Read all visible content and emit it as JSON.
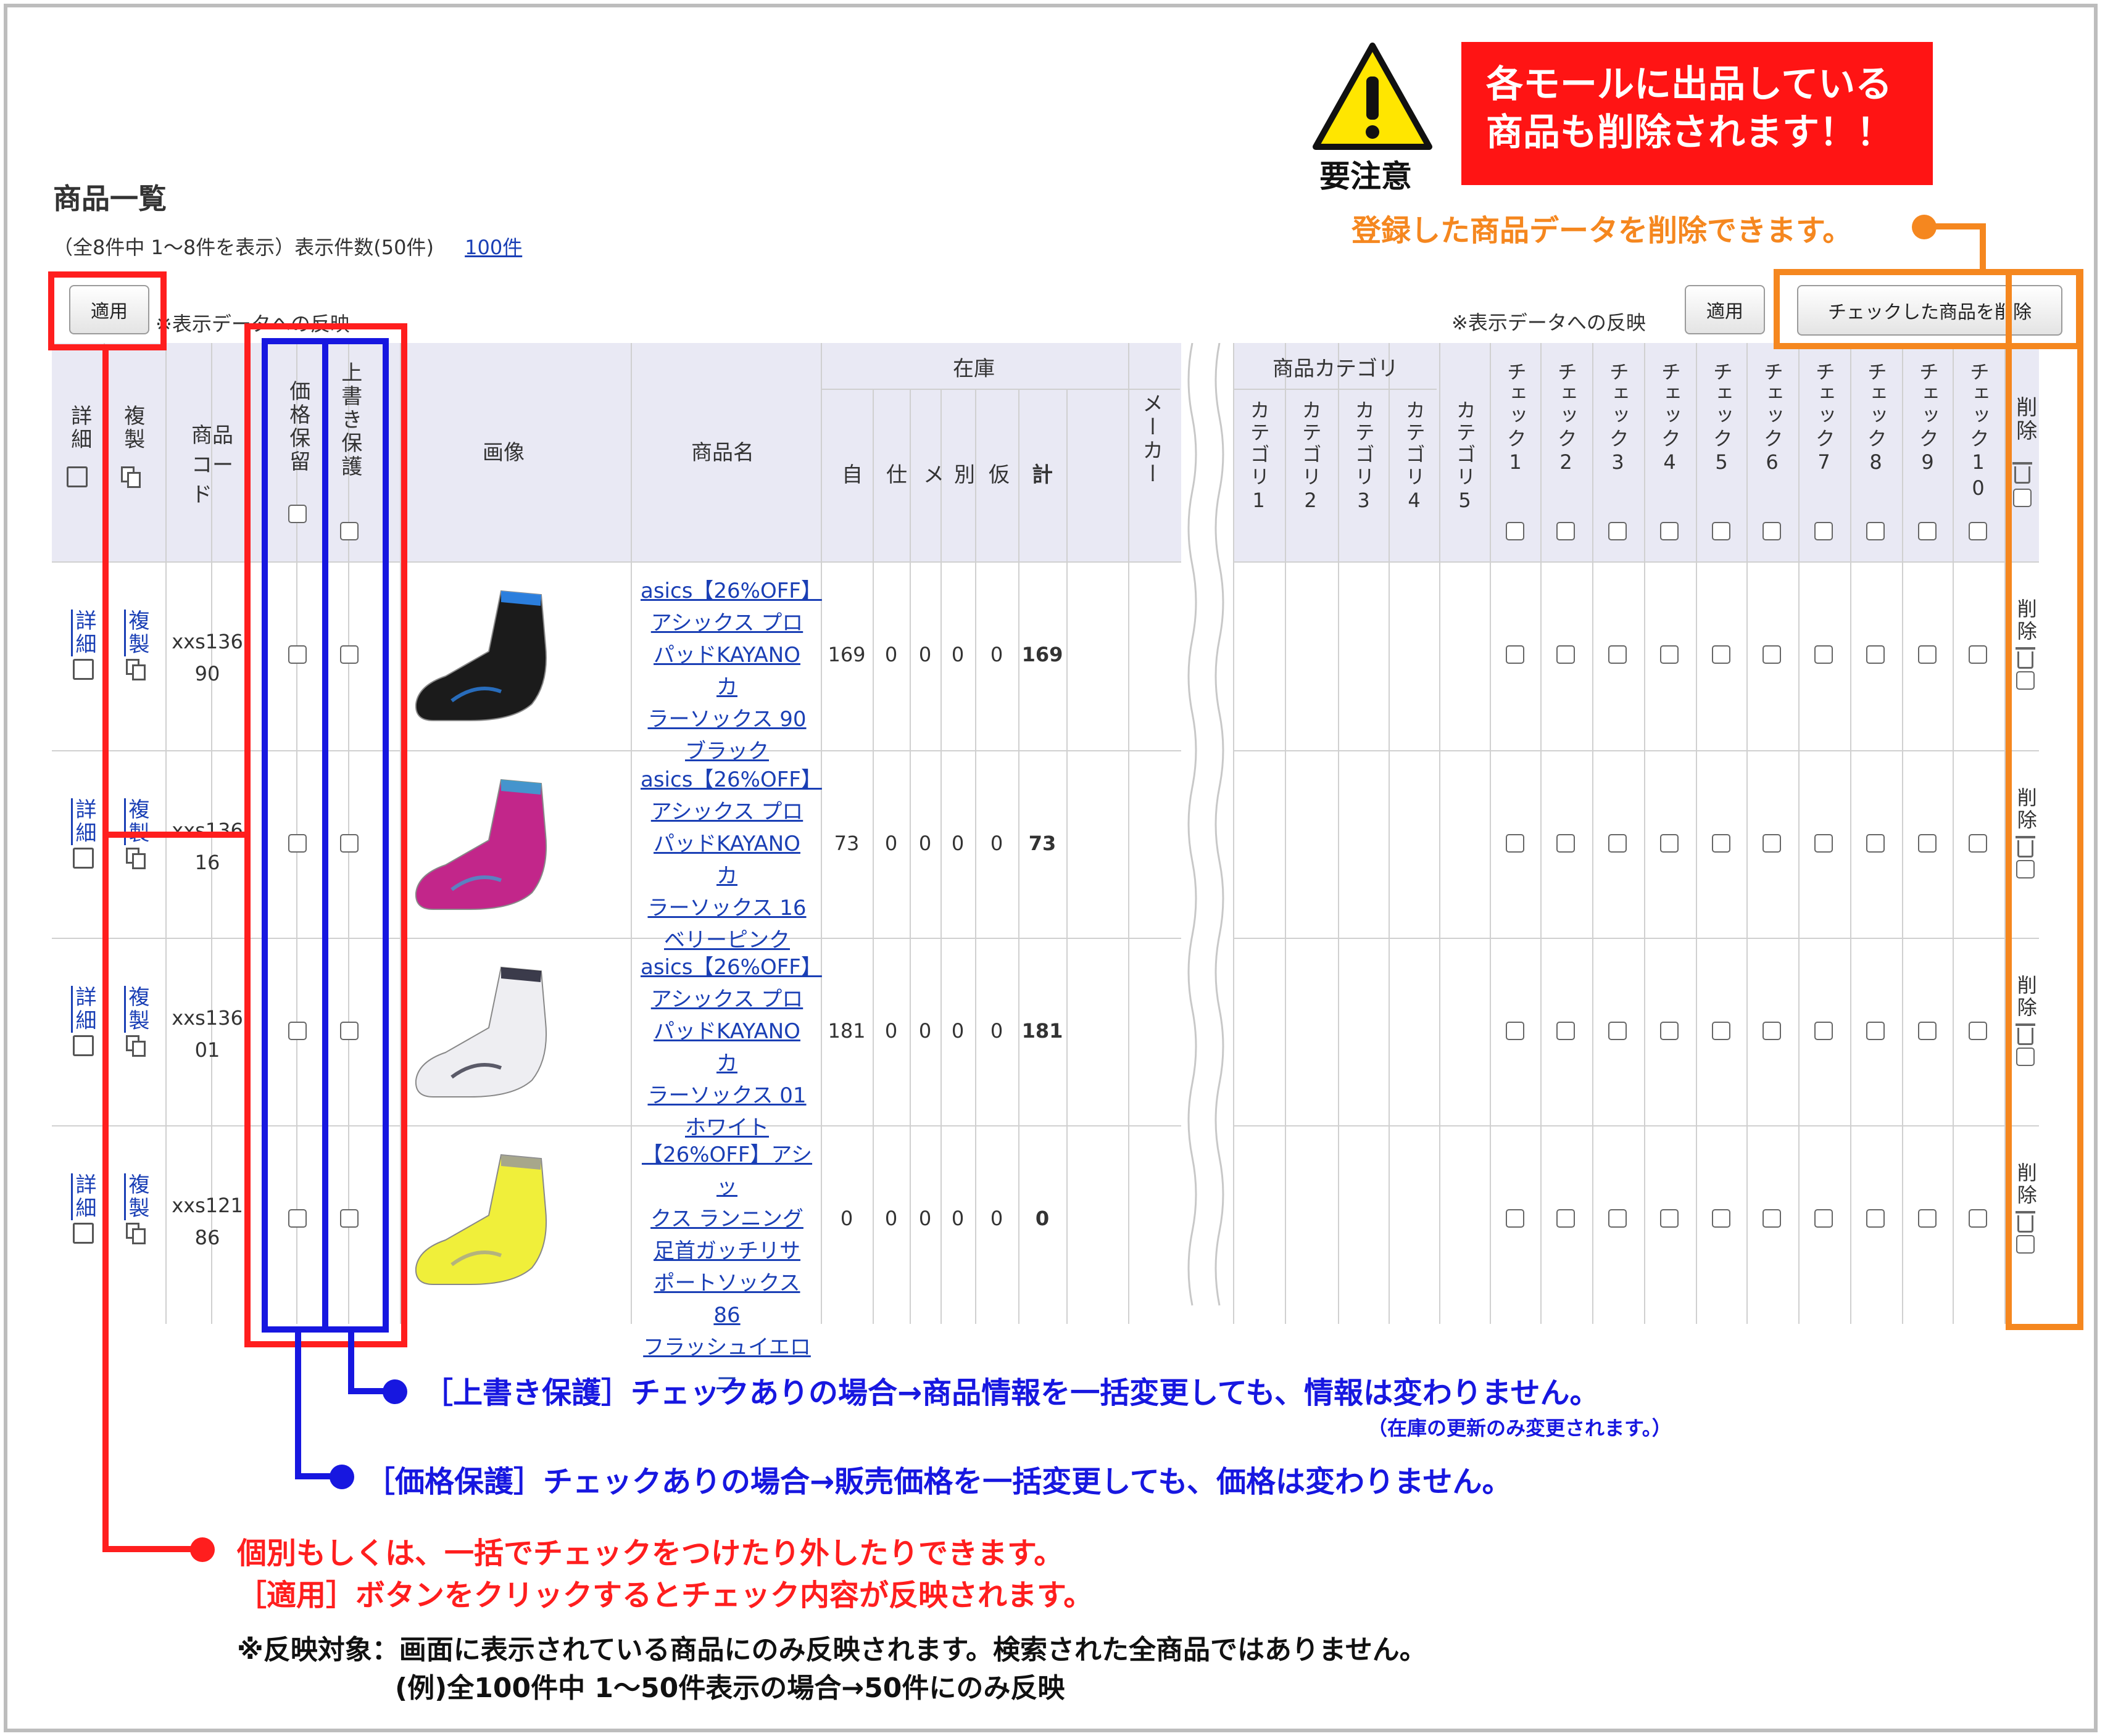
{
  "page": {
    "title": "商品一覧",
    "summary": "（全8件中 1〜8件を表示）表示件数(50件)",
    "per_page_link": "100件",
    "apply_label": "適用",
    "reflect_note": "※表示データへの反映",
    "delete_checked_label": "チェックした商品を削除"
  },
  "warning": {
    "caption": "要注意",
    "banner_line1": "各モールに出品している",
    "banner_line2": "商品も削除されます！！",
    "delete_note": "登録した商品データを削除できます。"
  },
  "headers": {
    "detail": "詳細",
    "copy": "複製",
    "code": "商品コード",
    "price_protect": "価格保留",
    "overwrite_protect": "上書き保護",
    "image": "画像",
    "name": "商品名",
    "stock": "在庫",
    "stock_cols": [
      "自",
      "仕",
      "メ",
      "別",
      "仮",
      "計"
    ],
    "maker": "メーカー",
    "category": "商品カテゴリ",
    "category_cols": [
      "カテゴリ1",
      "カテゴリ2",
      "カテゴリ3",
      "カテゴリ4",
      "カテゴリ5"
    ],
    "check_cols": [
      "チェック1",
      "チェック2",
      "チェック3",
      "チェック4",
      "チェック5",
      "チェック6",
      "チェック7",
      "チェック8",
      "チェック9",
      "チェック10"
    ],
    "delete": "削除"
  },
  "rows": [
    {
      "detail": "詳細",
      "copy": "複製",
      "code_line1": "xxs136",
      "code_line2": "90",
      "name_lines": [
        "asics【26%OFF】",
        "アシックス プロ",
        "パッドKAYANO カ",
        "ラーソックス 90",
        "ブラック"
      ],
      "stock": [
        "169",
        "0",
        "0",
        "0",
        "0",
        "169"
      ],
      "sock_color": "#1b1b1b",
      "sock_accent": "#2e8fff",
      "delete": "削除"
    },
    {
      "detail": "詳細",
      "copy": "複製",
      "code_line1": "xxs136",
      "code_line2": "16",
      "name_lines": [
        "asics【26%OFF】",
        "アシックス プロ",
        "パッドKAYANO カ",
        "ラーソックス 16",
        "ベリーピンク"
      ],
      "stock": [
        "73",
        "0",
        "0",
        "0",
        "0",
        "73"
      ],
      "sock_color": "#c2268a",
      "sock_accent": "#2fa8d8",
      "delete": "削除"
    },
    {
      "detail": "詳細",
      "copy": "複製",
      "code_line1": "xxs136",
      "code_line2": "01",
      "name_lines": [
        "asics【26%OFF】",
        "アシックス プロ",
        "パッドKAYANO カ",
        "ラーソックス 01",
        "ホワイト"
      ],
      "stock": [
        "181",
        "0",
        "0",
        "0",
        "0",
        "181"
      ],
      "sock_color": "#eeeef2",
      "sock_accent": "#1b1b2e",
      "delete": "削除"
    },
    {
      "detail": "詳細",
      "copy": "複製",
      "code_line1": "xxs121",
      "code_line2": "86",
      "name_lines": [
        "【26%OFF】アシッ",
        "クス ランニング",
        "足首ガッチリサ",
        "ポートソックス 86",
        "フラッシュイエロ",
        "ー"
      ],
      "stock": [
        "0",
        "0",
        "0",
        "0",
        "0",
        "0"
      ],
      "sock_color": "#f0ef3a",
      "sock_accent": "#9a9a9a",
      "delete": "削除"
    }
  ],
  "annotations": {
    "overwrite": "［上書き保護］チェックありの場合→商品情報を一括変更しても、情報は変わりません。",
    "overwrite_sub": "（在庫の更新のみ変更されます。）",
    "price": "［価格保護］チェックありの場合→販売価格を一括変更しても、価格は変わりません。",
    "check_line1": "個別もしくは、一括でチェックをつけたり外したりできます。",
    "check_line2": "［適用］ボタンをクリックするとチェック内容が反映されます。",
    "footnote_line1": "※反映対象：画面に表示されている商品にのみ反映されます。検索された全商品ではありません。",
    "footnote_line2": "(例)全100件中  1〜50件表示の場合→50件にのみ反映"
  },
  "colors": {
    "red": "#ff1e1e",
    "blue": "#1717e0",
    "orange": "#f5871f",
    "link": "#1a3fb5",
    "header_bg": "#e9e9f4"
  }
}
